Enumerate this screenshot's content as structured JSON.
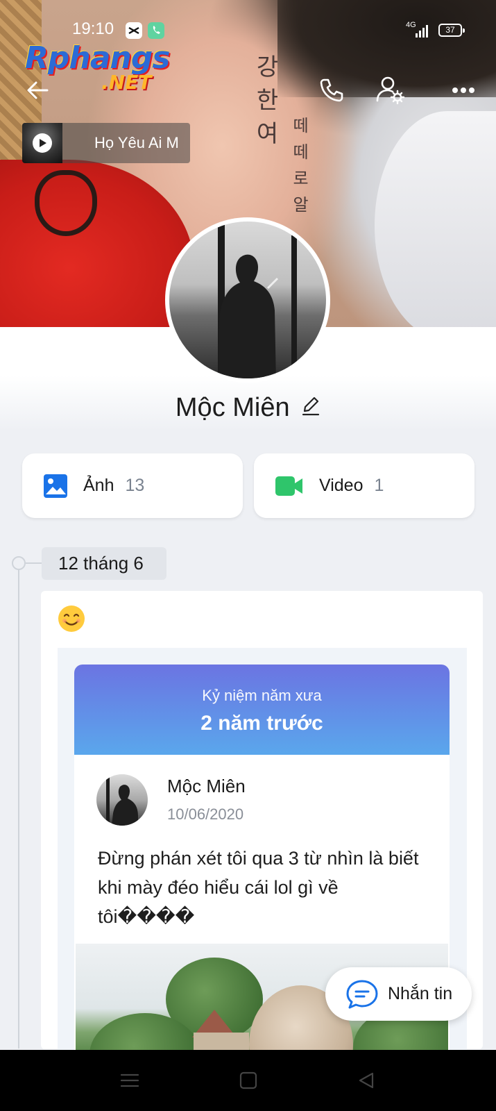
{
  "status_bar": {
    "time": "19:10",
    "network": "4G",
    "battery": "37"
  },
  "watermark": {
    "line1": "Rphangs",
    "line2": ".NET"
  },
  "music": {
    "title": "Họ Yêu Ai M"
  },
  "profile": {
    "name": "Mộc Miên"
  },
  "media": [
    {
      "label": "Ảnh",
      "count": "13",
      "icon": "image-icon",
      "color": "#1a73e8"
    },
    {
      "label": "Video",
      "count": "1",
      "icon": "video-camera-icon",
      "color": "#2fc56b"
    }
  ],
  "timeline": {
    "date_label": "12 tháng 6"
  },
  "post": {
    "emoji": "😊",
    "memory": {
      "subtitle": "Kỷ niệm năm xưa",
      "title": "2 năm trước",
      "author": "Mộc Miên",
      "date": "10/06/2020",
      "text": "Đừng phán xét tôi qua 3 từ nhìn là biết khi mày đéo hiểu cái lol gì về tôi����"
    }
  },
  "message_button": {
    "label": "Nhắn tin"
  },
  "colors": {
    "accent_blue": "#1a73e8",
    "video_green": "#2fc56b",
    "memory_gradient_top": "#6b74e2",
    "memory_gradient_bottom": "#5aa7ec"
  }
}
